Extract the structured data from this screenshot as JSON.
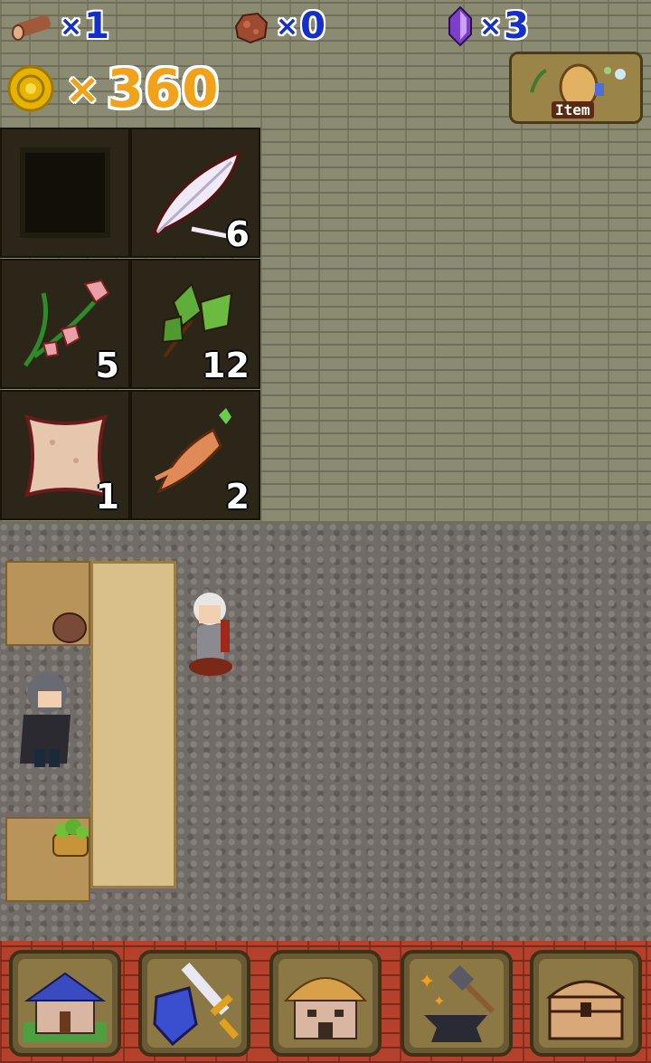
{
  "resources": {
    "wood": {
      "icon": "wood-log-icon",
      "times": "×",
      "count": "1"
    },
    "ore": {
      "icon": "ore-rock-icon",
      "times": "×",
      "count": "0"
    },
    "crystal": {
      "icon": "purple-crystal-icon",
      "times": "×",
      "count": "3"
    }
  },
  "gold": {
    "icon": "gold-coin-icon",
    "times": "×",
    "amount": "360"
  },
  "item_button": {
    "label": "Item"
  },
  "inventory": [
    {
      "icon": "empty-slot",
      "qty": ""
    },
    {
      "icon": "white-feather-icon",
      "qty": "6"
    },
    {
      "icon": "pink-flower-herb-icon",
      "qty": "5"
    },
    {
      "icon": "green-leaf-herb-icon",
      "qty": "12"
    },
    {
      "icon": "cloth-pouch-icon",
      "qty": "1"
    },
    {
      "icon": "mandrake-root-icon",
      "qty": "2"
    }
  ],
  "nav": [
    {
      "icon": "house-icon"
    },
    {
      "icon": "sword-shield-icon"
    },
    {
      "icon": "shop-hut-icon"
    },
    {
      "icon": "anvil-hammer-icon"
    },
    {
      "icon": "treasure-chest-icon"
    }
  ],
  "colors": {
    "resource_text": "#1530c8",
    "gold_text": "#f2a21a",
    "wall": "#8b8a73",
    "nav_brick": "#b4412c"
  }
}
